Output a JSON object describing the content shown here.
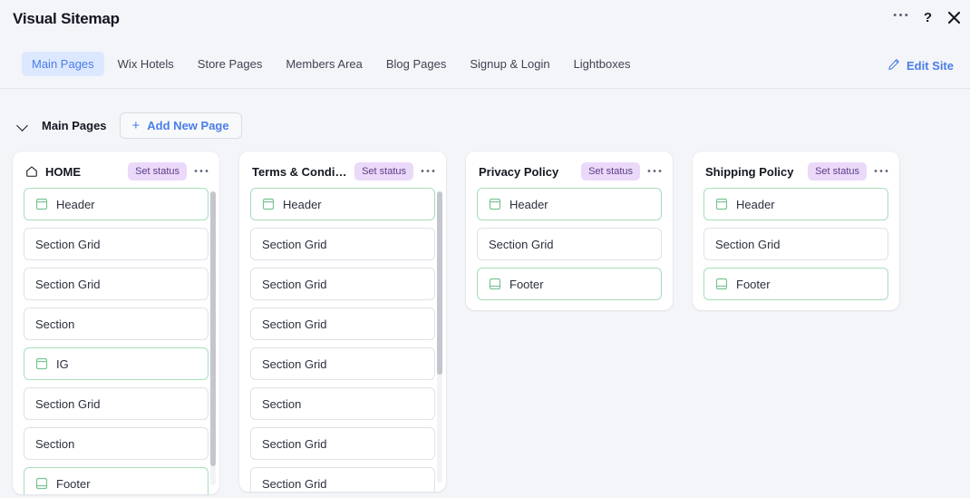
{
  "window": {
    "title": "Visual Sitemap",
    "actions": [
      {
        "name": "more-options",
        "glyph": "•••"
      },
      {
        "name": "help",
        "glyph": "?"
      },
      {
        "name": "close",
        "glyph": "✕"
      }
    ]
  },
  "tabs": [
    {
      "label": "Main Pages",
      "active": true
    },
    {
      "label": "Wix Hotels",
      "active": false
    },
    {
      "label": "Store Pages",
      "active": false
    },
    {
      "label": "Members Area",
      "active": false
    },
    {
      "label": "Blog Pages",
      "active": false
    },
    {
      "label": "Signup & Login",
      "active": false
    },
    {
      "label": "Lightboxes",
      "active": false
    }
  ],
  "edit_site": {
    "label": "Edit Site",
    "icon": "pencil-icon"
  },
  "section": {
    "label": "Main Pages",
    "add_button": {
      "label": "Add New Page",
      "plus": "+"
    },
    "collapse_icon": "chevron-down-icon"
  },
  "common": {
    "status_label": "Set status",
    "menu_glyph": "•••"
  },
  "colors": {
    "accent_blue": "#4a7de8",
    "tab_active_bg": "#dce8ff",
    "badge_bg": "#ebd9fa",
    "badge_text": "#5c3d86",
    "item_border": "#dfe2e9",
    "item_border_green": "#a8ddbc",
    "icon_green": "#7ac494",
    "page_bg": "#f4f5f9",
    "card_bg": "#ffffff"
  },
  "cards": [
    {
      "title": "HOME",
      "home_icon": true,
      "scroll": {
        "visible": true,
        "thumb_top": 0,
        "thumb_height": 303
      },
      "items": [
        {
          "label": "Header",
          "icon": "header-icon"
        },
        {
          "label": "Section Grid",
          "icon": null
        },
        {
          "label": "Section Grid",
          "icon": null
        },
        {
          "label": "Section",
          "icon": null
        },
        {
          "label": "IG",
          "icon": "header-icon"
        },
        {
          "label": "Section Grid",
          "icon": null
        },
        {
          "label": "Section",
          "icon": null
        },
        {
          "label": "Footer",
          "icon": "footer-icon"
        }
      ]
    },
    {
      "title": "Terms & Conditi...",
      "home_icon": false,
      "scroll": {
        "visible": true,
        "thumb_top": 0,
        "thumb_height": 202
      },
      "items": [
        {
          "label": "Header",
          "icon": "header-icon"
        },
        {
          "label": "Section Grid",
          "icon": null
        },
        {
          "label": "Section Grid",
          "icon": null
        },
        {
          "label": "Section Grid",
          "icon": null
        },
        {
          "label": "Section Grid",
          "icon": null
        },
        {
          "label": "Section",
          "icon": null
        },
        {
          "label": "Section Grid",
          "icon": null
        },
        {
          "label": "Section Grid",
          "icon": null
        }
      ]
    },
    {
      "title": "Privacy Policy",
      "home_icon": false,
      "scroll": {
        "visible": false,
        "thumb_top": 0,
        "thumb_height": 0
      },
      "items": [
        {
          "label": "Header",
          "icon": "header-icon"
        },
        {
          "label": "Section Grid",
          "icon": null
        },
        {
          "label": "Footer",
          "icon": "footer-icon"
        }
      ]
    },
    {
      "title": "Shipping Policy",
      "home_icon": false,
      "scroll": {
        "visible": false,
        "thumb_top": 0,
        "thumb_height": 0
      },
      "items": [
        {
          "label": "Header",
          "icon": "header-icon"
        },
        {
          "label": "Section Grid",
          "icon": null
        },
        {
          "label": "Footer",
          "icon": "footer-icon"
        }
      ]
    }
  ]
}
